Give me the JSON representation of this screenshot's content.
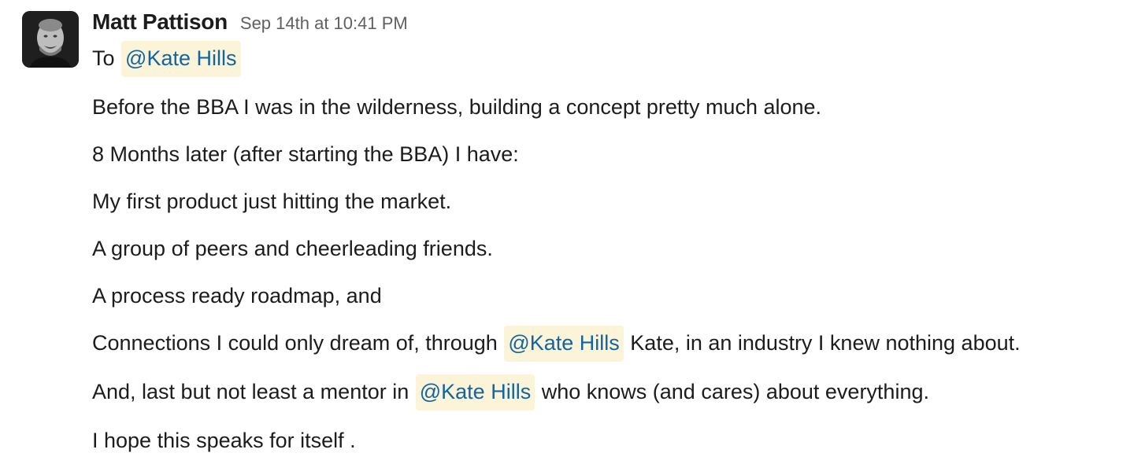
{
  "message": {
    "sender_name": "Matt Pattison",
    "timestamp": "Sep 14th at 10:41 PM",
    "lines": {
      "l0": {
        "pre": "To",
        "mention": "@Kate Hills",
        "post": ""
      },
      "l1": "Before the BBA I was in the wilderness, building a concept pretty much alone.",
      "l2": "8 Months later (after starting the BBA) I have:",
      "l3": "My first product just hitting the market.",
      "l4": "A group of peers and cheerleading friends.",
      "l5": "A process ready roadmap, and",
      "l6": {
        "pre": "Connections I could only dream of, through",
        "mention": "@Kate Hills",
        "post": "Kate, in an industry I knew nothing about."
      },
      "l7": {
        "pre": "And, last but not least a mentor in",
        "mention": "@Kate Hills",
        "post": "who knows (and cares) about everything."
      },
      "l8": "I hope this speaks for itself ."
    }
  },
  "colors": {
    "mention_bg": "#fcf4d8",
    "mention_text": "#1264a3",
    "text": "#1d1c1d",
    "timestamp": "#616061"
  }
}
